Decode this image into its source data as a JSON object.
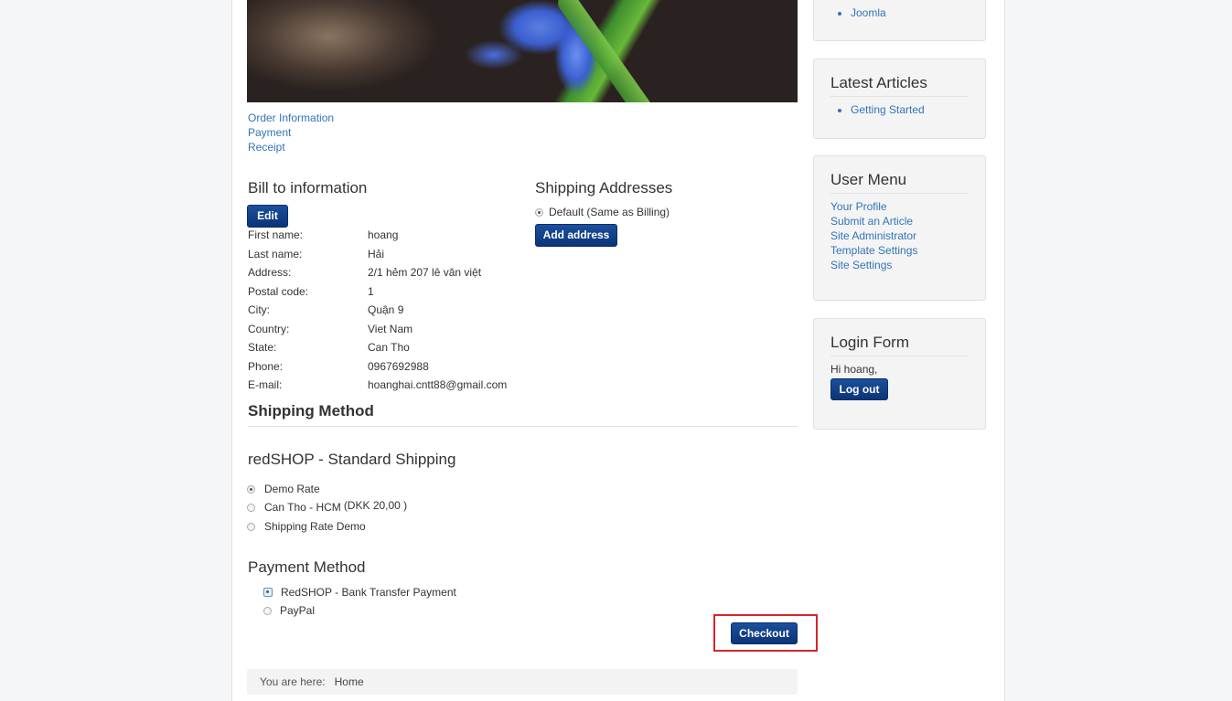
{
  "steps": [
    "Order Information",
    "Payment",
    "Receipt"
  ],
  "bill": {
    "title": "Bill to information",
    "edit_label": "Edit",
    "rows": [
      {
        "k": "First name:",
        "v": "hoang"
      },
      {
        "k": "Last name:",
        "v": "Hải"
      },
      {
        "k": "Address:",
        "v": "2/1 hẻm 207 lê văn việt"
      },
      {
        "k": "Postal code:",
        "v": "1"
      },
      {
        "k": "City:",
        "v": "Quận 9"
      },
      {
        "k": "Country:",
        "v": "Viet Nam"
      },
      {
        "k": "State:",
        "v": "Can Tho"
      },
      {
        "k": "Phone:",
        "v": "0967692988"
      },
      {
        "k": "E-mail:",
        "v": "hoanghai.cntt88@gmail.com"
      }
    ]
  },
  "shipping_addresses": {
    "title": "Shipping Addresses",
    "default_label": "Default (Same as Billing)",
    "add_label": "Add address"
  },
  "shipping_method": {
    "title": "Shipping Method",
    "provider": "redSHOP - Standard Shipping",
    "rates": [
      {
        "label": "Demo Rate",
        "extra": "",
        "selected": true
      },
      {
        "label": "Can Tho - HCM",
        "extra": "(DKK 20,00 )",
        "selected": false
      },
      {
        "label": "Shipping Rate Demo",
        "extra": "",
        "selected": false
      }
    ]
  },
  "payment_method": {
    "title": "Payment Method",
    "options": [
      {
        "label": "RedSHOP - Bank Transfer Payment",
        "selected": true
      },
      {
        "label": "PayPal",
        "selected": false
      }
    ]
  },
  "checkout_label": "Checkout",
  "breadcrumb": {
    "label": "You are here:",
    "home": "Home"
  },
  "sidebar": {
    "top_item": "Joomla",
    "latest": {
      "title": "Latest Articles",
      "items": [
        "Getting Started"
      ]
    },
    "user_menu": {
      "title": "User Menu",
      "items": [
        "Your Profile",
        "Submit an Article",
        "Site Administrator",
        "Template Settings",
        "Site Settings"
      ]
    },
    "login": {
      "title": "Login Form",
      "greeting": "Hi hoang,",
      "logout_label": "Log out"
    }
  }
}
